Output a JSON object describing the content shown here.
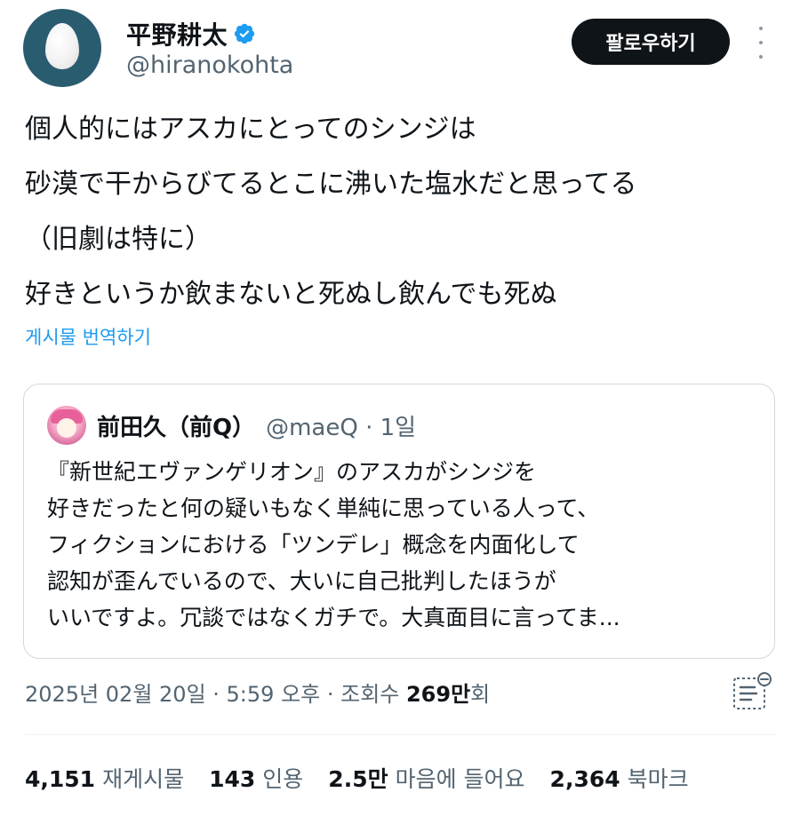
{
  "author": {
    "display_name": "平野耕太",
    "handle": "@hiranokohta",
    "verified": true,
    "avatar_icon": "egg-avatar"
  },
  "follow_button_label": "팔로우하기",
  "tweet": {
    "lines": [
      "個人的にはアスカにとってのシンジは",
      "砂漠で干からびてるとこに沸いた塩水だと思ってる",
      "（旧劇は特に）",
      "好きというか飲まないと死ぬし飲んでも死ぬ"
    ],
    "translate_label": "게시물 번역하기"
  },
  "quote": {
    "display_name": "前田久（前Q）",
    "handle": "@maeQ · 1일",
    "lines": [
      "『新世紀エヴァンゲリオン』のアスカがシンジを",
      "好きだったと何の疑いもなく単純に思っている人って、",
      "フィクションにおける「ツンデレ」概念を内面化して",
      "認知が歪んでいるので、大いに自己批判したほうが",
      "いいですよ。冗談ではなくガチで。大真面目に言ってま..."
    ]
  },
  "meta": {
    "timestamp": "2025년 02월 20일 · 5:59 오후 · 조회수 ",
    "views_number": "269만",
    "views_suffix": "회"
  },
  "stats": [
    {
      "number": "4,151",
      "label": "재게시물"
    },
    {
      "number": "143",
      "label": "인용"
    },
    {
      "number": "2.5만",
      "label": "마음에 들어요"
    },
    {
      "number": "2,364",
      "label": "북마크"
    }
  ],
  "colors": {
    "accent": "#1d9bf0",
    "text": "#0f1419",
    "secondary": "#536471",
    "follow_bg": "#0f1419"
  }
}
